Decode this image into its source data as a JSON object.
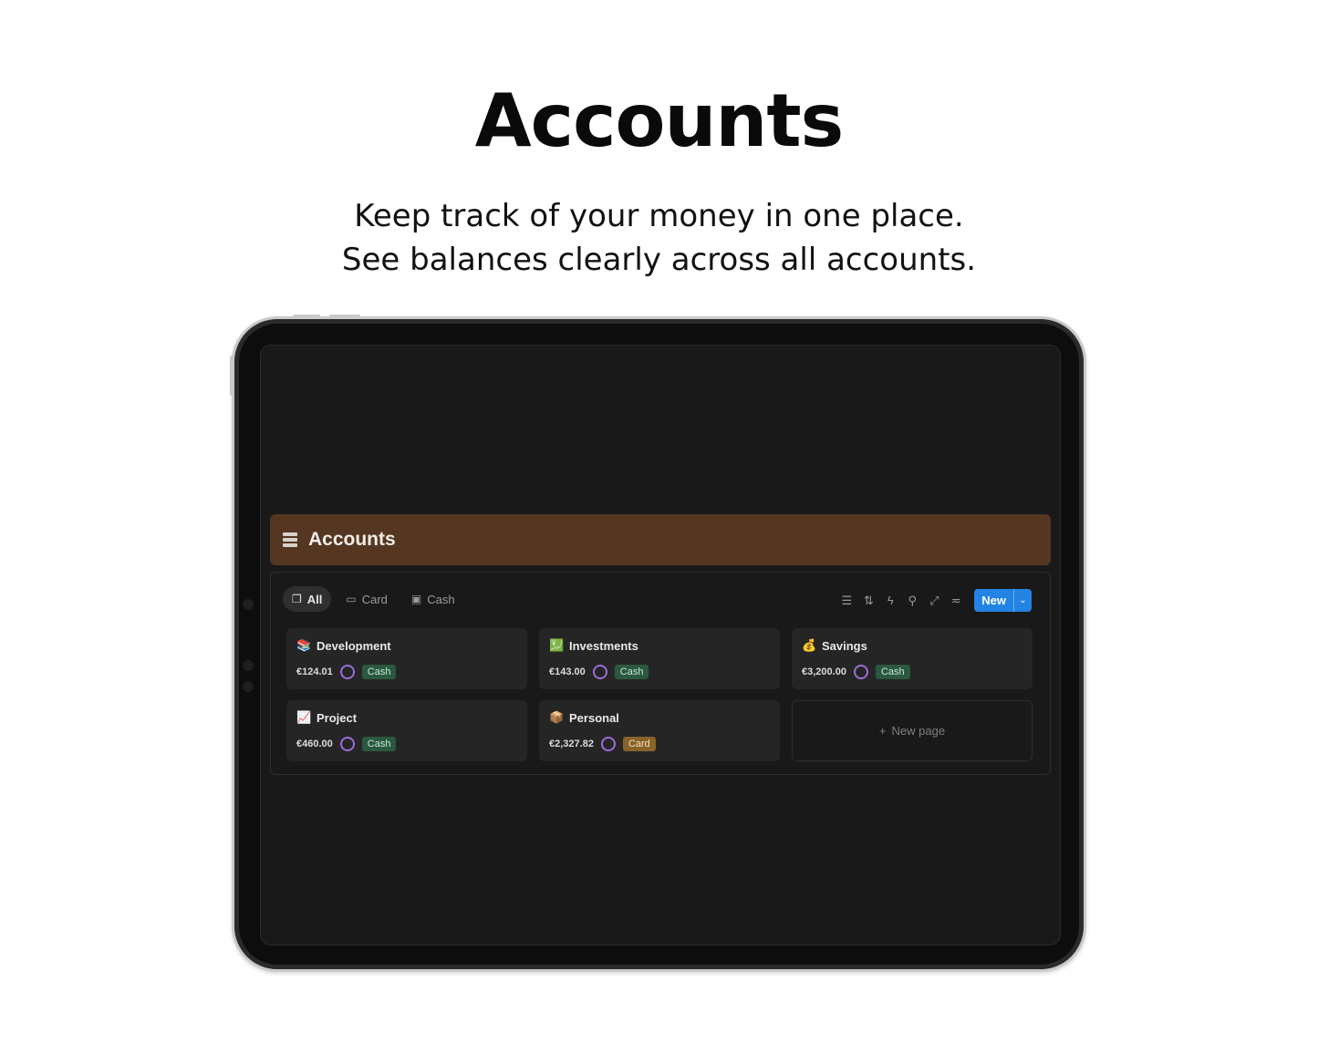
{
  "hero": {
    "title": "Accounts",
    "subtitle_line1": "Keep track of your money in one place.",
    "subtitle_line2": "See balances clearly across all accounts."
  },
  "app": {
    "page_title": "Accounts",
    "header_color": "#553621",
    "tabs": [
      {
        "label": "All",
        "icon": "stacked-cards-icon",
        "active": true
      },
      {
        "label": "Card",
        "icon": "credit-card-icon",
        "active": false
      },
      {
        "label": "Cash",
        "icon": "banknote-icon",
        "active": false
      }
    ],
    "toolbar": {
      "icons": [
        "filter-icon",
        "sort-icon",
        "automation-bolt-icon",
        "search-icon",
        "expand-icon",
        "settings-sliders-icon"
      ],
      "new_label": "New",
      "new_dropdown_icon": "chevron-down-icon",
      "accent": "#2383e2"
    },
    "accounts": [
      {
        "name": "Development",
        "emoji": "📚",
        "balance": "€124.01",
        "type": "Cash"
      },
      {
        "name": "Investments",
        "emoji": "💹",
        "balance": "€143.00",
        "type": "Cash"
      },
      {
        "name": "Savings",
        "emoji": "💰",
        "balance": "€3,200.00",
        "type": "Cash"
      },
      {
        "name": "Project",
        "emoji": "📈",
        "balance": "€460.00",
        "type": "Cash"
      },
      {
        "name": "Personal",
        "emoji": "📦",
        "balance": "€2,327.82",
        "type": "Card"
      }
    ],
    "new_page_label": "New page",
    "tag_colors": {
      "Cash": "#2b593f",
      "Card": "#89632a"
    }
  }
}
